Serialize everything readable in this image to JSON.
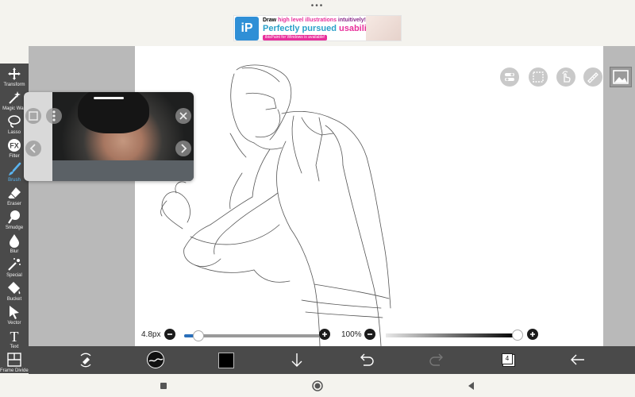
{
  "status": {
    "dots": "•••"
  },
  "ad": {
    "logo_text": "iP",
    "line1_a": "Draw ",
    "line1_b": "high level illustrations",
    "line1_c": " intuitively!",
    "line2_a": "Perfectly pursued ",
    "line2_b": "usability!",
    "line3": "ibisPaint for Windows is available!"
  },
  "tools": [
    {
      "id": "transform",
      "label": "Transform",
      "icon": "move-arrows-icon"
    },
    {
      "id": "magic-wand",
      "label": "Magic Wan",
      "icon": "magic-wand-icon"
    },
    {
      "id": "lasso",
      "label": "Lasso",
      "icon": "lasso-icon"
    },
    {
      "id": "filter",
      "label": "Filter",
      "icon": "fx-icon"
    },
    {
      "id": "brush",
      "label": "Brush",
      "icon": "brush-icon",
      "active": true
    },
    {
      "id": "eraser",
      "label": "Eraser",
      "icon": "eraser-icon"
    },
    {
      "id": "smudge",
      "label": "Smudge",
      "icon": "smudge-icon"
    },
    {
      "id": "blur",
      "label": "Blur",
      "icon": "drop-icon"
    },
    {
      "id": "special",
      "label": "Special",
      "icon": "sparkle-wand-icon"
    },
    {
      "id": "bucket",
      "label": "Bucket",
      "icon": "bucket-icon"
    },
    {
      "id": "vector",
      "label": "Vector",
      "icon": "cursor-icon"
    },
    {
      "id": "text",
      "label": "Text",
      "icon": "text-icon"
    },
    {
      "id": "frame-divider",
      "label": "Frame Divider",
      "icon": "frame-divider-icon"
    }
  ],
  "filter_glyph": "FX",
  "text_glyph": "T",
  "brush_slider": {
    "size_label": "4.8px",
    "fraction": 0.1
  },
  "opacity_slider": {
    "value_label": "100%",
    "fraction": 1.0
  },
  "current_color": "#000000",
  "layers": {
    "count": "4"
  },
  "accent_color": "#2a6fba"
}
